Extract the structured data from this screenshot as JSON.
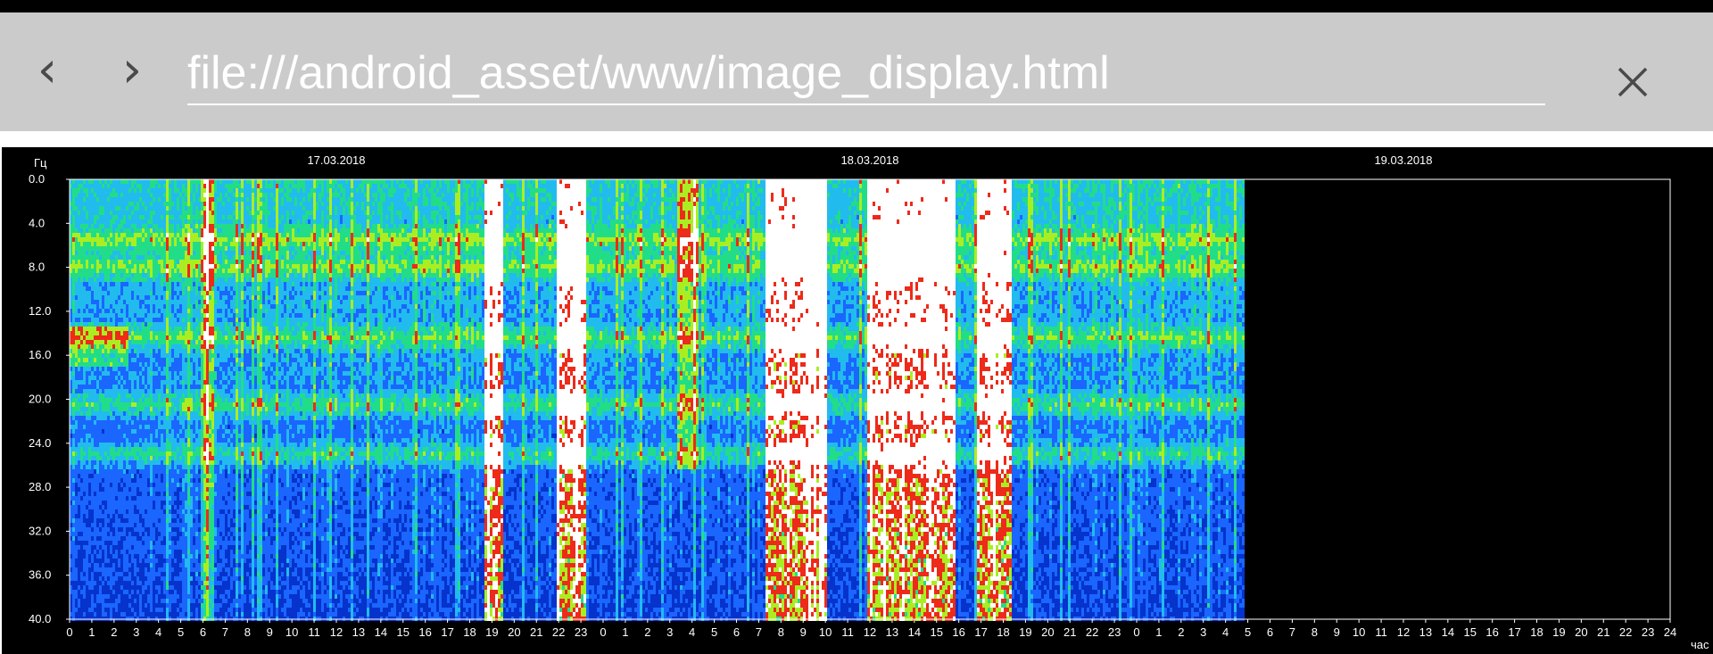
{
  "browser": {
    "back_icon": "chevron-left-icon",
    "forward_icon": "chevron-right-icon",
    "url": "file:///android_asset/www/image_display.html",
    "close_icon": "close-icon"
  },
  "chart_data": {
    "type": "heatmap",
    "y_unit_label": "Гц",
    "x_unit_label": "час",
    "y_ticks": [
      "0.0",
      "4.0",
      "8.0",
      "12.0",
      "16.0",
      "20.0",
      "24.0",
      "28.0",
      "32.0",
      "36.0",
      "40.0"
    ],
    "ylim": [
      0,
      40
    ],
    "dates": [
      "17.03.2018",
      "18.03.2018",
      "19.03.2018"
    ],
    "x_ticks": [
      "0",
      "1",
      "2",
      "3",
      "4",
      "5",
      "6",
      "7",
      "8",
      "9",
      "10",
      "11",
      "12",
      "13",
      "14",
      "15",
      "16",
      "17",
      "18",
      "19",
      "20",
      "21",
      "22",
      "23",
      "0",
      "1",
      "2",
      "3",
      "4",
      "5",
      "6",
      "7",
      "8",
      "9",
      "10",
      "11",
      "12",
      "13",
      "14",
      "15",
      "16",
      "17",
      "18",
      "19",
      "20",
      "21",
      "22",
      "23",
      "0",
      "1",
      "2",
      "3",
      "4",
      "5",
      "6",
      "7",
      "8",
      "9",
      "10",
      "11",
      "12",
      "13",
      "14",
      "15",
      "16",
      "17",
      "18",
      "19",
      "20",
      "21",
      "22",
      "23",
      "24"
    ],
    "data_available_until_hour": 52.8,
    "intensity_colors": [
      "#001a66",
      "#0533cc",
      "#1a66ff",
      "#22bbee",
      "#22dd88",
      "#aaee22",
      "#ee2a1a",
      "#ffffff"
    ],
    "saturated_periods_hours": [
      [
        18.6,
        19.5
      ],
      [
        21.8,
        23.2
      ],
      [
        31.3,
        34.0
      ],
      [
        35.8,
        39.8
      ],
      [
        40.7,
        42.3
      ]
    ],
    "activity_bands_hz": [
      5.3,
      7.8,
      14.2,
      20.3,
      24.8
    ],
    "grid": false,
    "legend": "none"
  }
}
